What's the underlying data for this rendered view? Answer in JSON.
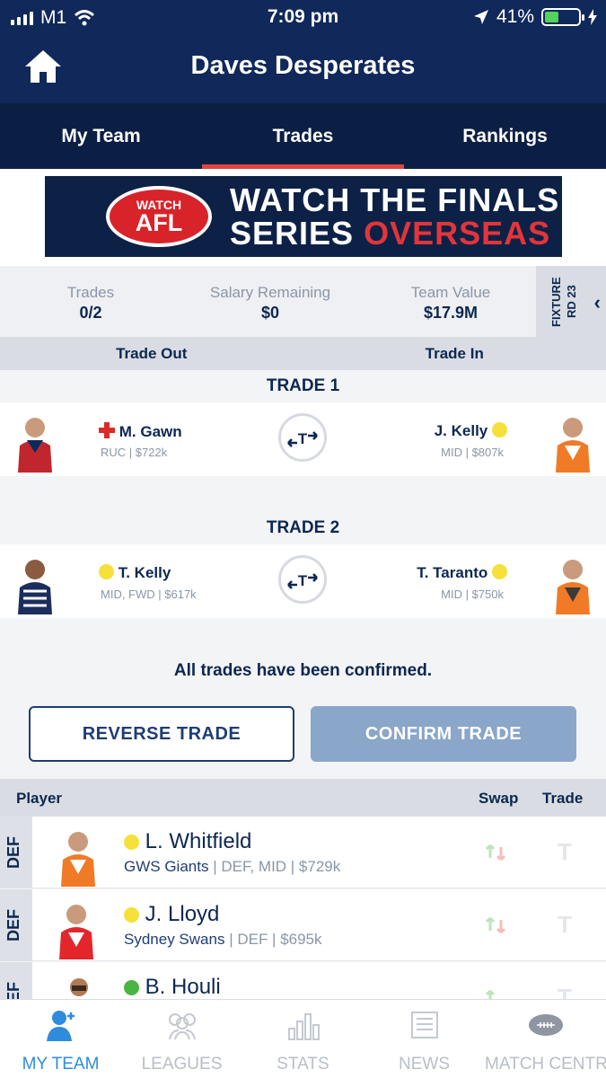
{
  "status_bar": {
    "carrier": "M1",
    "time": "7:09 pm",
    "battery": "41%",
    "battery_level": 0.41
  },
  "header": {
    "title": "Daves Desperates"
  },
  "tabs": [
    {
      "label": "My Team",
      "active": false
    },
    {
      "label": "Trades",
      "active": true
    },
    {
      "label": "Rankings",
      "active": false
    }
  ],
  "banner": {
    "logo_top": "WATCH",
    "logo_main": "AFL",
    "line1": "WATCH THE FINALS",
    "line2_a": "SERIES",
    "line2_b": "OVERSEAS"
  },
  "summary": {
    "trades_label": "Trades",
    "trades_value": "0/2",
    "salary_label": "Salary Remaining",
    "salary_value": "$0",
    "value_label": "Team Value",
    "value_value": "$17.9M",
    "fixture": "FIXTURE RD 23"
  },
  "trade_columns": {
    "out": "Trade Out",
    "in": "Trade In"
  },
  "trades": [
    {
      "label": "TRADE 1",
      "out": {
        "name": "M. Gawn",
        "meta": "RUC | $722k",
        "status": "injured"
      },
      "in": {
        "name": "J. Kelly",
        "meta": "MID | $807k",
        "status": "test"
      }
    },
    {
      "label": "TRADE 2",
      "out": {
        "name": "T. Kelly",
        "meta": "MID, FWD | $617k",
        "status": "test"
      },
      "in": {
        "name": "T. Taranto",
        "meta": "MID | $750k",
        "status": "test"
      }
    }
  ],
  "confirmation_message": "All trades have been confirmed.",
  "buttons": {
    "reverse": "REVERSE TRADE",
    "confirm": "CONFIRM TRADE"
  },
  "player_list": {
    "headers": {
      "player": "Player",
      "swap": "Swap",
      "trade": "Trade"
    },
    "rows": [
      {
        "position": "DEF",
        "name": "L. Whitfield",
        "team": "GWS Giants",
        "meta": "| DEF, MID | $729k",
        "status": "yellow",
        "trade_icon": "T"
      },
      {
        "position": "DEF",
        "name": "J. Lloyd",
        "team": "Sydney Swans",
        "meta": "| DEF | $695k",
        "status": "yellow",
        "trade_icon": "T"
      },
      {
        "position": "DEF",
        "name": "B. Houli",
        "team": "",
        "meta": "",
        "status": "green",
        "trade_icon": "T"
      }
    ]
  },
  "bottom_nav": [
    {
      "label": "MY TEAM",
      "icon": "user-add-icon",
      "active": true
    },
    {
      "label": "LEAGUES",
      "icon": "group-icon",
      "active": false
    },
    {
      "label": "STATS",
      "icon": "bar-chart-icon",
      "active": false
    },
    {
      "label": "NEWS",
      "icon": "newspaper-icon",
      "active": false
    },
    {
      "label": "MATCH CENTRE",
      "icon": "football-icon",
      "active": false
    }
  ],
  "colors": {
    "header": "#10285a",
    "tabs": "#0b1f44",
    "accent_red": "#e2443f",
    "nav_active": "#2e8cdc"
  }
}
